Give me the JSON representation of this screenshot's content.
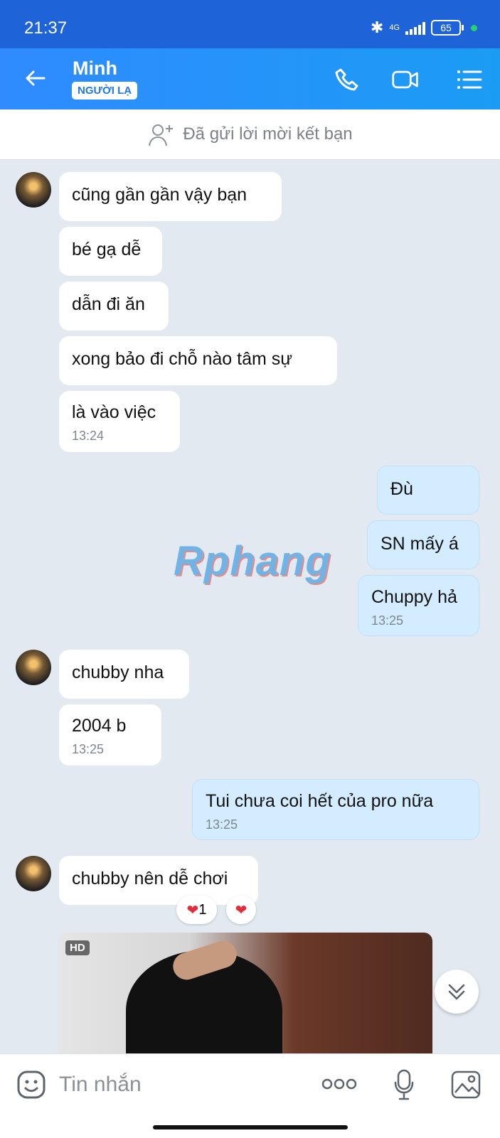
{
  "status_bar": {
    "time": "21:37",
    "network": "4G",
    "battery": "65"
  },
  "header": {
    "contact_name": "Minh",
    "badge": "NGƯỜI LẠ"
  },
  "friend_notice": "Đã gửi lời mời kết bạn",
  "watermark": "Rphang",
  "messages": [
    {
      "text": "cũng gần gần vậy bạn"
    },
    {
      "text": "bé gạ dễ"
    },
    {
      "text": "dẫn đi ăn"
    },
    {
      "text": "xong bảo đi chỗ nào tâm sự"
    },
    {
      "text": "là vào việc",
      "time": "13:24"
    },
    {
      "text": "Đù"
    },
    {
      "text": "SN mấy á"
    },
    {
      "text": "Chuppy hả",
      "time": "13:25"
    },
    {
      "text": "chubby nha"
    },
    {
      "text": "2004 b",
      "time": "13:25"
    },
    {
      "text": "Tui chưa coi hết của pro nữa",
      "time": "13:25"
    },
    {
      "text": "chubby nên dễ chơi"
    }
  ],
  "reactions": {
    "heart": "❤",
    "count": "1"
  },
  "media": {
    "quality_badge": "HD"
  },
  "composer": {
    "placeholder": "Tin nhắn"
  },
  "colors": {
    "header_blue": "#2f8bff",
    "incoming_bubble": "#ffffff",
    "outgoing_bubble": "#d3ecff",
    "chat_background": "#e2e9f1"
  },
  "icons": [
    "back-arrow-icon",
    "phone-icon",
    "video-call-icon",
    "menu-list-icon",
    "add-friend-icon",
    "emoji-icon",
    "more-options-icon",
    "microphone-icon",
    "image-icon",
    "scroll-down-icon"
  ]
}
